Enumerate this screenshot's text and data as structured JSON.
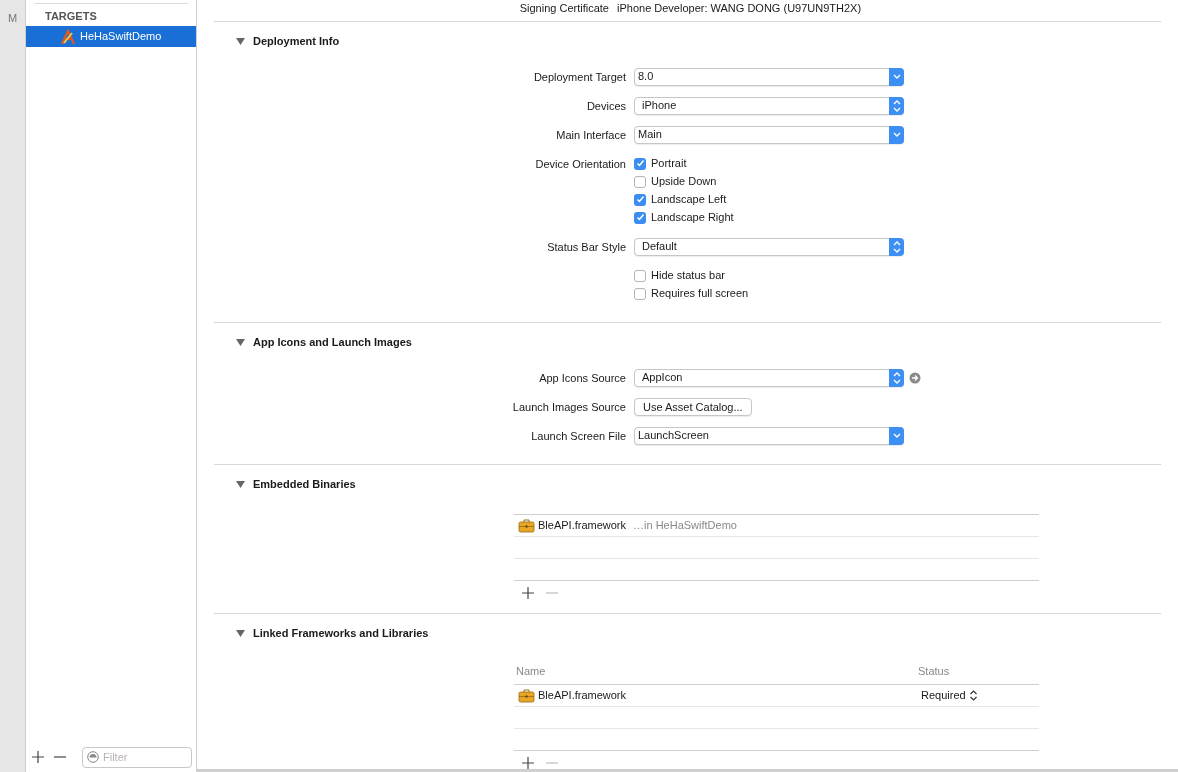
{
  "sidebar": {
    "strip_letter": "M",
    "section_header": "TARGETS",
    "items": [
      {
        "label": "HeHaSwiftDemo",
        "selected": true
      }
    ],
    "filter": {
      "placeholder": "Filter"
    }
  },
  "signing": {
    "label": "Signing Certificate",
    "value": "iPhone Developer: WANG DONG (U97UN9TH2X)"
  },
  "sections": [
    {
      "title": "Deployment Info",
      "expanded": true,
      "rows": [
        {
          "kind": "combo",
          "label": "Deployment Target",
          "value": "8.0"
        },
        {
          "kind": "popup",
          "label": "Devices",
          "value": "iPhone",
          "link": false
        },
        {
          "kind": "combo",
          "label": "Main Interface",
          "value": "Main"
        },
        {
          "kind": "checkboxes",
          "label": "Device Orientation",
          "options": [
            {
              "label": "Portrait",
              "checked": true
            },
            {
              "label": "Upside Down",
              "checked": false
            },
            {
              "label": "Landscape Left",
              "checked": true
            },
            {
              "label": "Landscape Right",
              "checked": true
            }
          ]
        },
        {
          "kind": "popup",
          "label": "Status Bar Style",
          "value": "Default",
          "link": false
        },
        {
          "kind": "checkboxes",
          "options": [
            {
              "label": "Hide status bar",
              "checked": false
            },
            {
              "label": "Requires full screen",
              "checked": false
            }
          ]
        }
      ]
    },
    {
      "title": "App Icons and Launch Images",
      "expanded": true,
      "rows": [
        {
          "kind": "popup",
          "label": "App Icons Source",
          "value": "AppIcon",
          "link": true
        },
        {
          "kind": "button",
          "label": "Launch Images Source",
          "value": "Use Asset Catalog..."
        },
        {
          "kind": "combo",
          "label": "Launch Screen File",
          "value": "LaunchScreen"
        }
      ]
    },
    {
      "title": "Embedded Binaries",
      "expanded": true,
      "rows": [
        {
          "kind": "table",
          "items": [
            {
              "name": "BleAPI.framework",
              "detail": "…in HeHaSwiftDemo"
            }
          ]
        }
      ]
    },
    {
      "title": "Linked Frameworks and Libraries",
      "expanded": true,
      "rows": [
        {
          "kind": "table",
          "columns": [
            "Name",
            "Status"
          ],
          "items": [
            {
              "name": "BleAPI.framework",
              "status": "Required"
            }
          ]
        }
      ]
    }
  ]
}
